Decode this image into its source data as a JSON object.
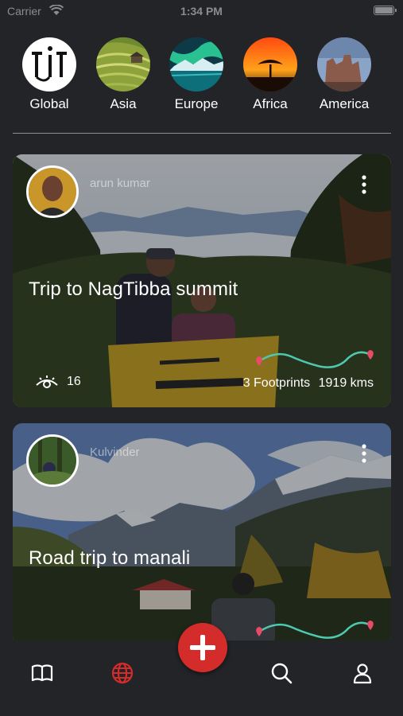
{
  "status_bar": {
    "carrier": "Carrier",
    "time": "1:34 PM"
  },
  "regions": [
    {
      "label": "Global",
      "icon": "global-logo-icon"
    },
    {
      "label": "Asia",
      "icon": "rice-terraces-photo"
    },
    {
      "label": "Europe",
      "icon": "aurora-photo"
    },
    {
      "label": "Africa",
      "icon": "savanna-sunset-photo"
    },
    {
      "label": "America",
      "icon": "monument-valley-photo"
    }
  ],
  "feed": [
    {
      "author": "arun kumar",
      "title": "Trip to NagTibba summit",
      "views": "16",
      "footprints": "3 Footprints",
      "distance": "1919 kms"
    },
    {
      "author": "Kulvinder",
      "title": "Road trip to manali"
    }
  ],
  "nav": {
    "items": [
      "book-icon",
      "globe-icon",
      "add-icon",
      "search-icon",
      "profile-icon"
    ],
    "active": "globe-icon"
  },
  "colors": {
    "background": "#222427",
    "accent": "#d42b2b",
    "route": "#4fc8b0",
    "pin": "#e94a66"
  }
}
